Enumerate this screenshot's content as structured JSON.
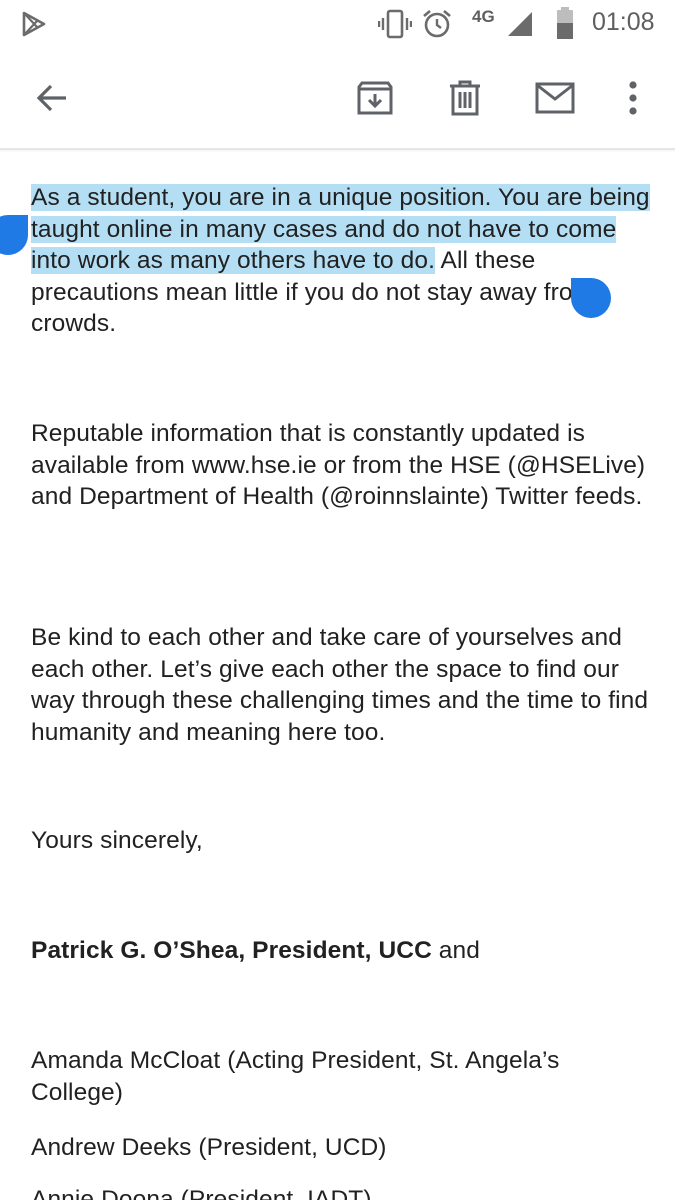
{
  "status_bar": {
    "network": "4G",
    "time": "01:08"
  },
  "toolbar": {
    "back": "back-arrow-icon",
    "archive": "archive-icon",
    "delete": "trash-icon",
    "mark_unread": "mail-icon",
    "more": "more-vert-icon"
  },
  "email": {
    "p1_selected": "As a student, you are in a unique position. You are being taught online in many cases and do not have to come into work as many others have to do.",
    "p1_rest": " All these precautions mean little if you do not stay away from crowds.",
    "p2": "Reputable information that is constantly updated is available from www.hse.ie or from the HSE (@HSELive) and Department of Health (@roinnslainte) Twitter feeds.",
    "p3": "Be kind to each other and take care of yourselves and each other.  Let’s give each other the space to find our way through these challenging times and the time to find humanity and meaning here too.",
    "closing": "Yours sincerely,",
    "sig_bold": "Patrick G. O’Shea, President, UCC",
    "sig_rest": " and",
    "sig2": "Amanda McCloat (Acting President, St. Angela’s College)",
    "sig3": "Andrew Deeks (President, UCD)",
    "sig4": "Annie Doona (President, IADT)"
  },
  "colors": {
    "selection": "#b4def3",
    "handle": "#1f7ae6",
    "icon": "#5f6368"
  }
}
